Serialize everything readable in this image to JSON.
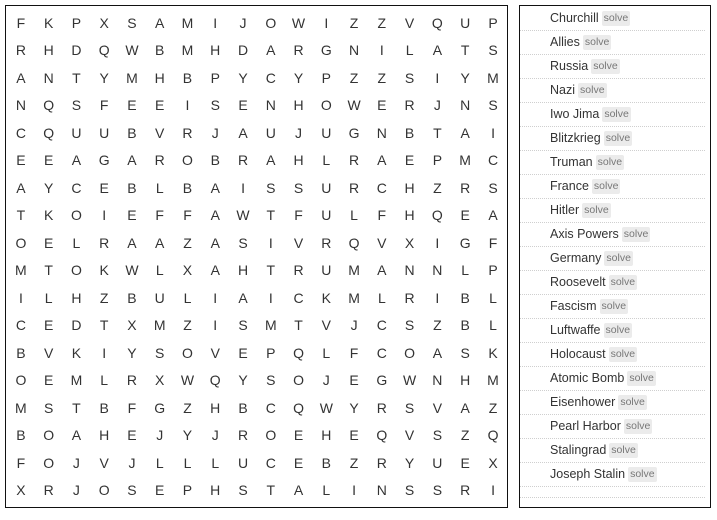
{
  "grid": {
    "rows": [
      [
        "F",
        "K",
        "P",
        "X",
        "S",
        "A",
        "M",
        "I",
        "J",
        "O",
        "W",
        "I",
        "Z",
        "Z",
        "V",
        "Q",
        "U",
        "P"
      ],
      [
        "R",
        "H",
        "D",
        "Q",
        "W",
        "B",
        "M",
        "H",
        "D",
        "A",
        "R",
        "G",
        "N",
        "I",
        "L",
        "A",
        "T",
        "S"
      ],
      [
        "A",
        "N",
        "T",
        "Y",
        "M",
        "H",
        "B",
        "P",
        "Y",
        "C",
        "Y",
        "P",
        "Z",
        "Z",
        "S",
        "I",
        "Y",
        "M"
      ],
      [
        "N",
        "Q",
        "S",
        "F",
        "E",
        "E",
        "I",
        "S",
        "E",
        "N",
        "H",
        "O",
        "W",
        "E",
        "R",
        "J",
        "N",
        "S"
      ],
      [
        "C",
        "Q",
        "U",
        "U",
        "B",
        "V",
        "R",
        "J",
        "A",
        "U",
        "J",
        "U",
        "G",
        "N",
        "B",
        "T",
        "A",
        "I"
      ],
      [
        "E",
        "E",
        "A",
        "G",
        "A",
        "R",
        "O",
        "B",
        "R",
        "A",
        "H",
        "L",
        "R",
        "A",
        "E",
        "P",
        "M",
        "C"
      ],
      [
        "A",
        "Y",
        "C",
        "E",
        "B",
        "L",
        "B",
        "A",
        "I",
        "S",
        "S",
        "U",
        "R",
        "C",
        "H",
        "Z",
        "R",
        "S"
      ],
      [
        "T",
        "K",
        "O",
        "I",
        "E",
        "F",
        "F",
        "A",
        "W",
        "T",
        "F",
        "U",
        "L",
        "F",
        "H",
        "Q",
        "E",
        "A"
      ],
      [
        "O",
        "E",
        "L",
        "R",
        "A",
        "A",
        "Z",
        "A",
        "S",
        "I",
        "V",
        "R",
        "Q",
        "V",
        "X",
        "I",
        "G",
        "F"
      ],
      [
        "M",
        "T",
        "O",
        "K",
        "W",
        "L",
        "X",
        "A",
        "H",
        "T",
        "R",
        "U",
        "M",
        "A",
        "N",
        "N",
        "L",
        "P"
      ],
      [
        "I",
        "L",
        "H",
        "Z",
        "B",
        "U",
        "L",
        "I",
        "A",
        "I",
        "C",
        "K",
        "M",
        "L",
        "R",
        "I",
        "B",
        "L"
      ],
      [
        "C",
        "E",
        "D",
        "T",
        "X",
        "M",
        "Z",
        "I",
        "S",
        "M",
        "T",
        "V",
        "J",
        "C",
        "S",
        "Z",
        "B",
        "L"
      ],
      [
        "B",
        "V",
        "K",
        "I",
        "Y",
        "S",
        "O",
        "V",
        "E",
        "P",
        "Q",
        "L",
        "F",
        "C",
        "O",
        "A",
        "S",
        "K"
      ],
      [
        "O",
        "E",
        "M",
        "L",
        "R",
        "X",
        "W",
        "Q",
        "Y",
        "S",
        "O",
        "J",
        "E",
        "G",
        "W",
        "N",
        "H",
        "M"
      ],
      [
        "M",
        "S",
        "T",
        "B",
        "F",
        "G",
        "Z",
        "H",
        "B",
        "C",
        "Q",
        "W",
        "Y",
        "R",
        "S",
        "V",
        "A",
        "Z"
      ],
      [
        "B",
        "O",
        "A",
        "H",
        "E",
        "J",
        "Y",
        "J",
        "R",
        "O",
        "E",
        "H",
        "E",
        "Q",
        "V",
        "S",
        "Z",
        "Q"
      ],
      [
        "F",
        "O",
        "J",
        "V",
        "J",
        "L",
        "L",
        "L",
        "U",
        "C",
        "E",
        "B",
        "Z",
        "R",
        "Y",
        "U",
        "E",
        "X"
      ],
      [
        "X",
        "R",
        "J",
        "O",
        "S",
        "E",
        "P",
        "H",
        "S",
        "T",
        "A",
        "L",
        "I",
        "N",
        "S",
        "S",
        "R",
        "I"
      ]
    ]
  },
  "word_list": {
    "solve_label": "solve",
    "words": [
      "Churchill",
      "Allies",
      "Russia",
      "Nazi",
      "Iwo Jima",
      "Blitzkrieg",
      "Truman",
      "France",
      "Hitler",
      "Axis Powers",
      "Germany",
      "Roosevelt",
      "Fascism",
      "Luftwaffe",
      "Holocaust",
      "Atomic Bomb",
      "Eisenhower",
      "Pearl Harbor",
      "Stalingrad",
      "Joseph Stalin"
    ]
  }
}
